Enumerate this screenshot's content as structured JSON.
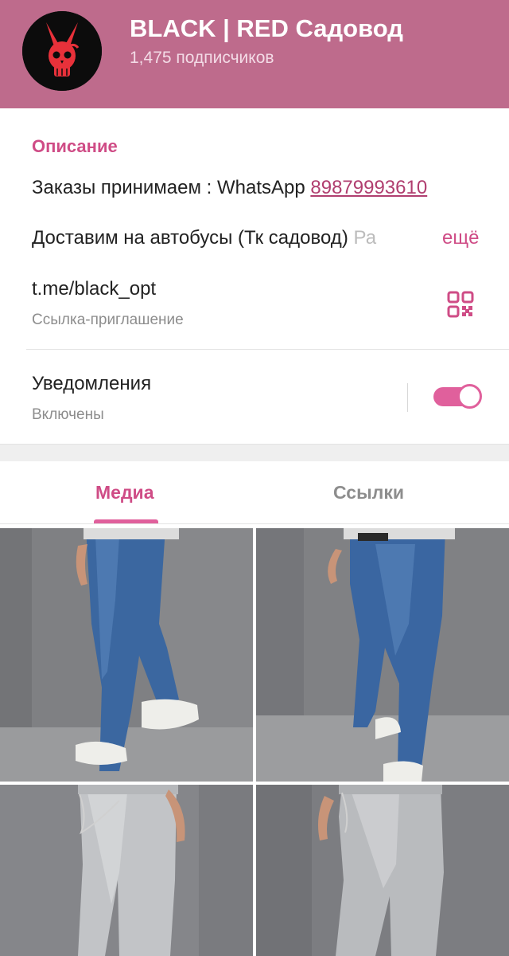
{
  "channel": {
    "title": "BLACK | RED Садовод",
    "subscribers": "1,475 подписчиков",
    "avatar_icon": "bunny-skull-logo"
  },
  "description": {
    "section_title": "Описание",
    "line1_text": "Заказы принимаем : WhatsApp ",
    "line1_phone": "89879993610",
    "line2_text": "Доставим на автобусы (Тк садовод) ",
    "line2_faded": "Ра",
    "more_label": "ещё"
  },
  "invite": {
    "link": "t.me/black_opt",
    "caption": "Ссылка-приглашение",
    "icon": "qr-code-icon"
  },
  "notifications": {
    "title": "Уведомления",
    "status": "Включены",
    "enabled": true
  },
  "tabs": [
    {
      "label": "Медиа",
      "active": true
    },
    {
      "label": "Ссылки",
      "active": false
    }
  ],
  "media": [
    {
      "name": "blue-jeans-photo-1"
    },
    {
      "name": "blue-jeans-photo-2"
    },
    {
      "name": "grey-jeans-photo-1"
    },
    {
      "name": "grey-jeans-photo-2"
    }
  ],
  "colors": {
    "header_bg": "#be6b8c",
    "accent": "#cf4c86",
    "toggle_on": "#e0609c",
    "logo_red": "#e8313a"
  }
}
